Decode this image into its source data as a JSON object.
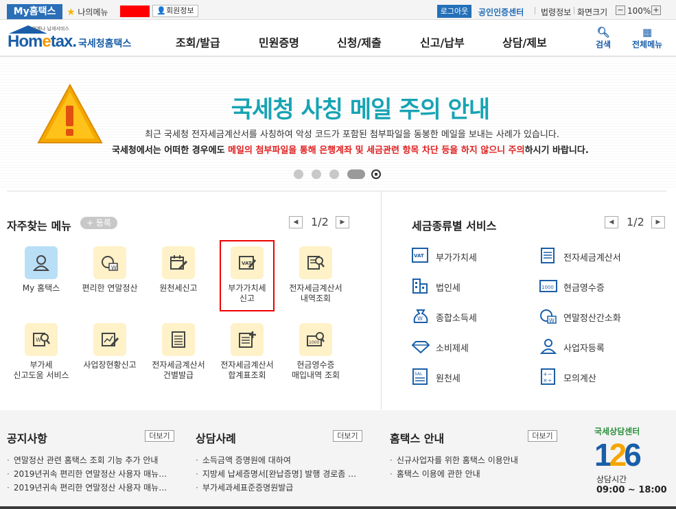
{
  "topbar": {
    "my_hometax": "My홈택스",
    "my_menu": "나의메뉴",
    "member_info": "회원정보",
    "logout": "로그아웃",
    "cert_center": "공인인증센터",
    "law_info": "법령정보",
    "screen_size": "화면크기",
    "zoom_minus": "−",
    "zoom_value": "100%",
    "zoom_plus": "+"
  },
  "header": {
    "logo_sub": "언제나 납세서비스",
    "logo_main_pre": "Hom",
    "logo_main_e": "e",
    "logo_main_post": "tax.",
    "logo_kr": "국세청홈택스",
    "nav": [
      "조회/발급",
      "민원증명",
      "신청/제출",
      "신고/납부",
      "상담/제보"
    ],
    "search": "검색",
    "all_menu": "전체메뉴"
  },
  "banner": {
    "title": "국세청 사칭 메일 주의 안내",
    "line1": "최근 국세청 전자세금계산서를 사칭하여 악성 코드가 포함된 첨부파일을 동봉한 메일을 보내는 사례가 있습니다.",
    "line2_a": "국세청에서는 어떠한 경우에도 ",
    "line2_red": "메일의 첨부파일을 통해 은행계좌 및 세금관련 항목 차단 등을 하지 않으니 주의",
    "line2_b": "하시기 바랍니다."
  },
  "freq_menu": {
    "title": "자주찾는 메뉴",
    "register": "+ 등록",
    "page": "1/2",
    "items": [
      {
        "label1": "My 홈택스",
        "label2": ""
      },
      {
        "label1": "편리한 연말정산",
        "label2": ""
      },
      {
        "label1": "원천세신고",
        "label2": ""
      },
      {
        "label1": "부가가치세",
        "label2": "신고"
      },
      {
        "label1": "전자세금계산서",
        "label2": "내역조회"
      },
      {
        "label1": "부가세",
        "label2": "신고도움 서비스"
      },
      {
        "label1": "사업장현황신고",
        "label2": ""
      },
      {
        "label1": "전자세금계산서",
        "label2": "건별발급"
      },
      {
        "label1": "전자세금계산서",
        "label2": "합계표조회"
      },
      {
        "label1": "현금영수증",
        "label2": "매입내역 조회"
      }
    ]
  },
  "tax_services": {
    "title": "세금종류별 서비스",
    "page": "1/2",
    "items": [
      "부가가치세",
      "전자세금계산서",
      "법인세",
      "현금영수증",
      "종합소득세",
      "연말정산간소화",
      "소비제세",
      "사업자등록",
      "원천세",
      "모의계산"
    ]
  },
  "board": {
    "notice": {
      "title": "공지사항",
      "more": "더보기",
      "items": [
        "연말정산 관련 홈택스 조회 기능 추가 안내",
        "2019년귀속 편리한 연말정산 사용자 매뉴…",
        "2019년귀속 편리한 연말정산 사용자 매뉴…"
      ]
    },
    "cases": {
      "title": "상담사례",
      "more": "더보기",
      "items": [
        "소득금액 증명원에 대하여",
        "지방세 납세증명서[완납증명] 발행 경로좀 …",
        "부가세과세표준증명원발급"
      ]
    },
    "guide": {
      "title": "홈택스 안내",
      "more": "더보기",
      "items": [
        "신규사업자를 위한 홈택스 이용안내",
        "홈택스 이용에 관한 안내"
      ]
    },
    "center": {
      "title": "국세상담센터",
      "num_a": "1",
      "num_b": "2",
      "num_c": "6",
      "hours_label": "상담시간",
      "hours": "09:00 ~ 18:00"
    }
  },
  "colors": {
    "brand_blue": "#1a5ea8",
    "banner_teal": "#17a3b4",
    "alert_red": "#e02020",
    "icon_bg": "#fff1c8"
  }
}
